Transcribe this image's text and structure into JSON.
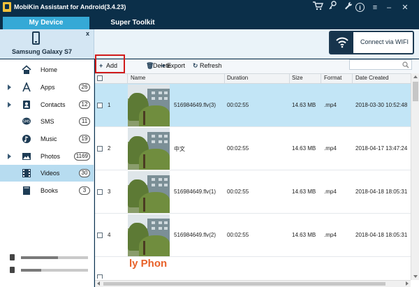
{
  "app": {
    "title": "MobiKin Assistant for Android(3.4.23)"
  },
  "window_controls": {
    "info": "i",
    "menu": "≡",
    "minimize": "–",
    "close": "✕"
  },
  "tabs": [
    {
      "label": "My Device",
      "active": true
    },
    {
      "label": "Super Toolkit",
      "active": false
    }
  ],
  "device": {
    "name": "Samsung Galaxy S7",
    "close": "x"
  },
  "wifi": {
    "label": "Connect via WIFI"
  },
  "sidebar": {
    "items": [
      {
        "label": "Home",
        "count": null,
        "icon": "home-icon",
        "expandable": false
      },
      {
        "label": "Apps",
        "count": "26",
        "icon": "apps-icon",
        "expandable": true
      },
      {
        "label": "Contacts",
        "count": "12",
        "icon": "contacts-icon",
        "expandable": true
      },
      {
        "label": "SMS",
        "count": "11",
        "icon": "sms-icon",
        "expandable": false
      },
      {
        "label": "Music",
        "count": "19",
        "icon": "music-icon",
        "expandable": false
      },
      {
        "label": "Photos",
        "count": "1169",
        "icon": "photos-icon",
        "expandable": true
      },
      {
        "label": "Videos",
        "count": "30",
        "icon": "videos-icon",
        "expandable": false,
        "selected": true
      },
      {
        "label": "Books",
        "count": "3",
        "icon": "books-icon",
        "expandable": false
      }
    ],
    "storage": [
      {
        "icon": "phone-storage-icon",
        "used_fraction": 0.55
      },
      {
        "icon": "sd-card-icon",
        "used_fraction": 0.3
      }
    ]
  },
  "toolbar": {
    "add": "Add",
    "delete": "Delete",
    "export": "Export",
    "refresh": "Refresh",
    "search_placeholder": ""
  },
  "table": {
    "columns": [
      "Name",
      "Duration",
      "Size",
      "Format",
      "Date Created"
    ],
    "rows": [
      {
        "num": "1",
        "name": "516984649.flv(3)",
        "duration": "00:02:55",
        "size": "14.63 MB",
        "format": ".mp4",
        "date": "2018-03-30 10:52:48",
        "selected": true
      },
      {
        "num": "2",
        "name": "中文",
        "duration": "00:02:55",
        "size": "14.63 MB",
        "format": ".mp4",
        "date": "2018-04-17 13:47:24"
      },
      {
        "num": "3",
        "name": "516984649.flv(1)",
        "duration": "00:02:55",
        "size": "14.63 MB",
        "format": ".mp4",
        "date": "2018-04-18 18:05:31"
      },
      {
        "num": "4",
        "name": "516984649.flv(2)",
        "duration": "00:02:55",
        "size": "14.63 MB",
        "format": ".mp4",
        "date": "2018-04-18 18:05:31"
      }
    ],
    "partial_row": {
      "thumb_text": "ly Phon"
    }
  },
  "colors": {
    "accent": "#35a9d6",
    "titlebar": "#0b2f49",
    "selected_row": "#c2e5f6",
    "highlight_box": "#d11b1b",
    "promo": "#e8622a"
  }
}
